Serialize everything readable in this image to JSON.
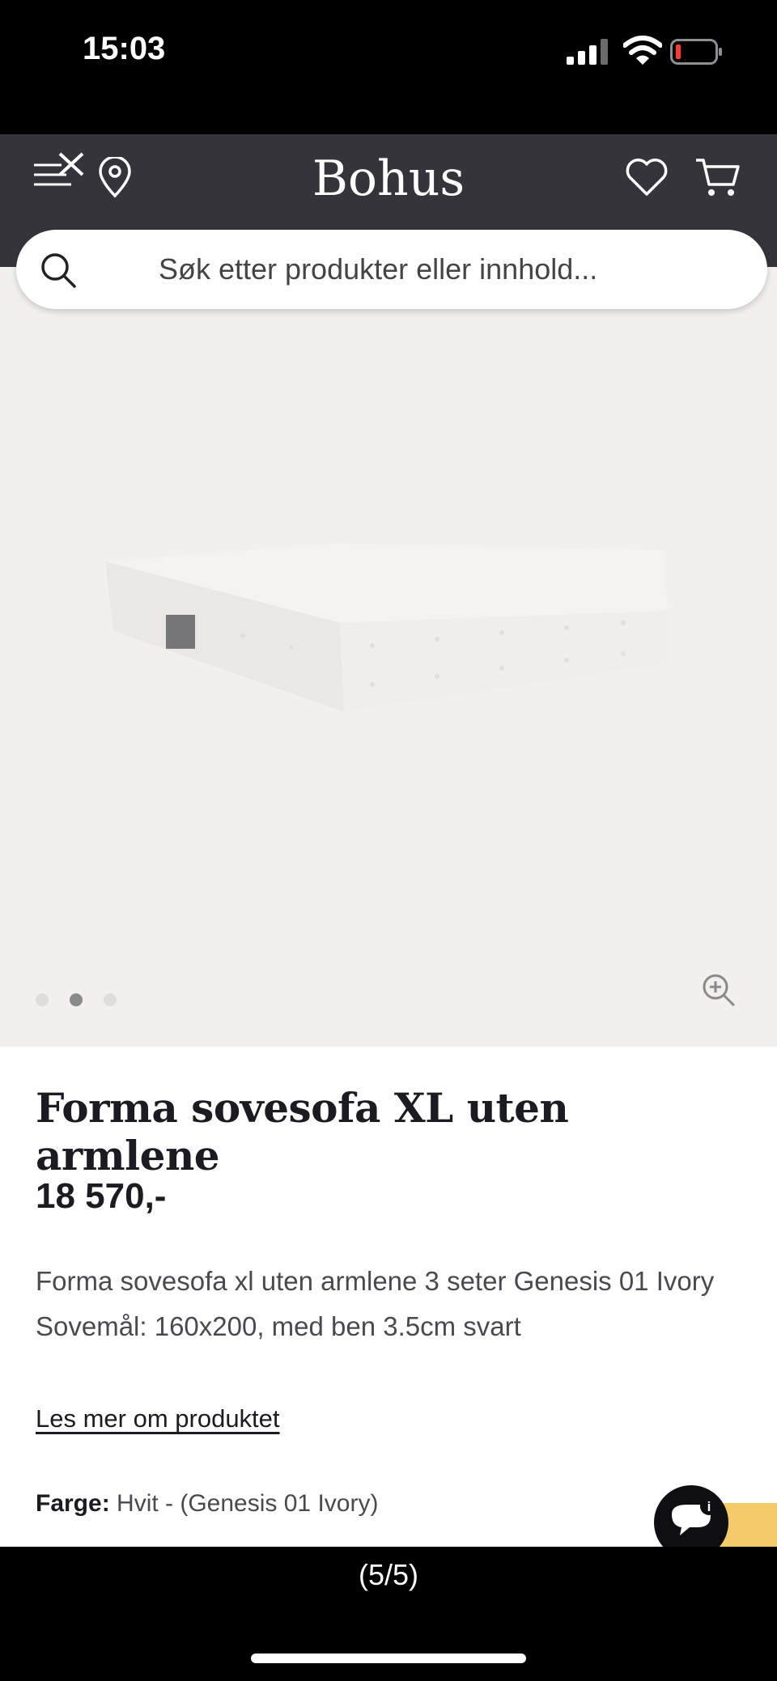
{
  "status_bar": {
    "time": "15:03"
  },
  "header": {
    "brand": "Bohus",
    "search_placeholder": "Søk etter produkter eller innhold..."
  },
  "gallery": {
    "dots": [
      {
        "active": false
      },
      {
        "active": true
      },
      {
        "active": false
      }
    ]
  },
  "product": {
    "title": "Forma sovesofa XL uten armlene",
    "price": "18 570,-",
    "description": "Forma sovesofa xl uten armlene 3 seter Genesis 01 Ivory Sovemål: 160x200, med ben 3.5cm svart",
    "read_more": "Les mer om produktet",
    "color_label": "Farge:",
    "color_value": "Hvit - (Genesis 01 Ivory)"
  },
  "viewer": {
    "page_counter": "(5/5)"
  },
  "colors": {
    "header_bg": "#34343a",
    "gallery_bg": "#f1f0ee",
    "text_dark": "#1c1b22",
    "accent_yellow": "#f5cb6a"
  }
}
